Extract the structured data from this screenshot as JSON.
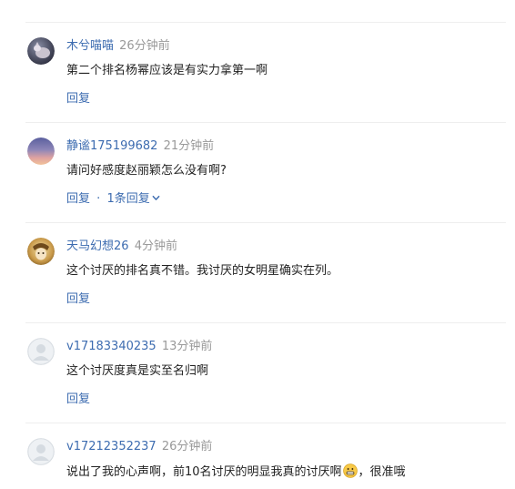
{
  "comments": [
    {
      "username": "木兮喵喵",
      "time": "26分钟前",
      "text": "第二个排名杨幂应该是有实力拿第一啊",
      "reply_label": "回复",
      "avatar_icon": "user-avatar-cat-icon"
    },
    {
      "username": "静谧175199682",
      "time": "21分钟前",
      "text": "请问好感度赵丽颖怎么没有啊?",
      "reply_label": "回复",
      "separator": "·",
      "reply_count_label": "1条回复",
      "expand_icon": "chevron-down-icon",
      "avatar_icon": "user-avatar-sunset-icon"
    },
    {
      "username": "天马幻想26",
      "time": "4分钟前",
      "text": "这个讨厌的排名真不错。我讨厌的女明星确实在列。",
      "reply_label": "回复",
      "avatar_icon": "user-avatar-anime-icon"
    },
    {
      "username": "v17183340235",
      "time": "13分钟前",
      "text": "这个讨厌度真是实至名归啊",
      "reply_label": "回复",
      "avatar_icon": "default-avatar-icon"
    },
    {
      "username": "v17212352237",
      "time": "26分钟前",
      "text_before_emoji": "说出了我的心声啊，前10名讨厌的明显我真的讨厌啊",
      "emoji_icon": "grimace-emoji-icon",
      "text_after_emoji": "，很准哦",
      "avatar_icon": "default-avatar-icon"
    }
  ],
  "colors": {
    "link": "#3d6cb0",
    "time": "#999999",
    "text": "#222222",
    "divider": "#eeeeee"
  }
}
